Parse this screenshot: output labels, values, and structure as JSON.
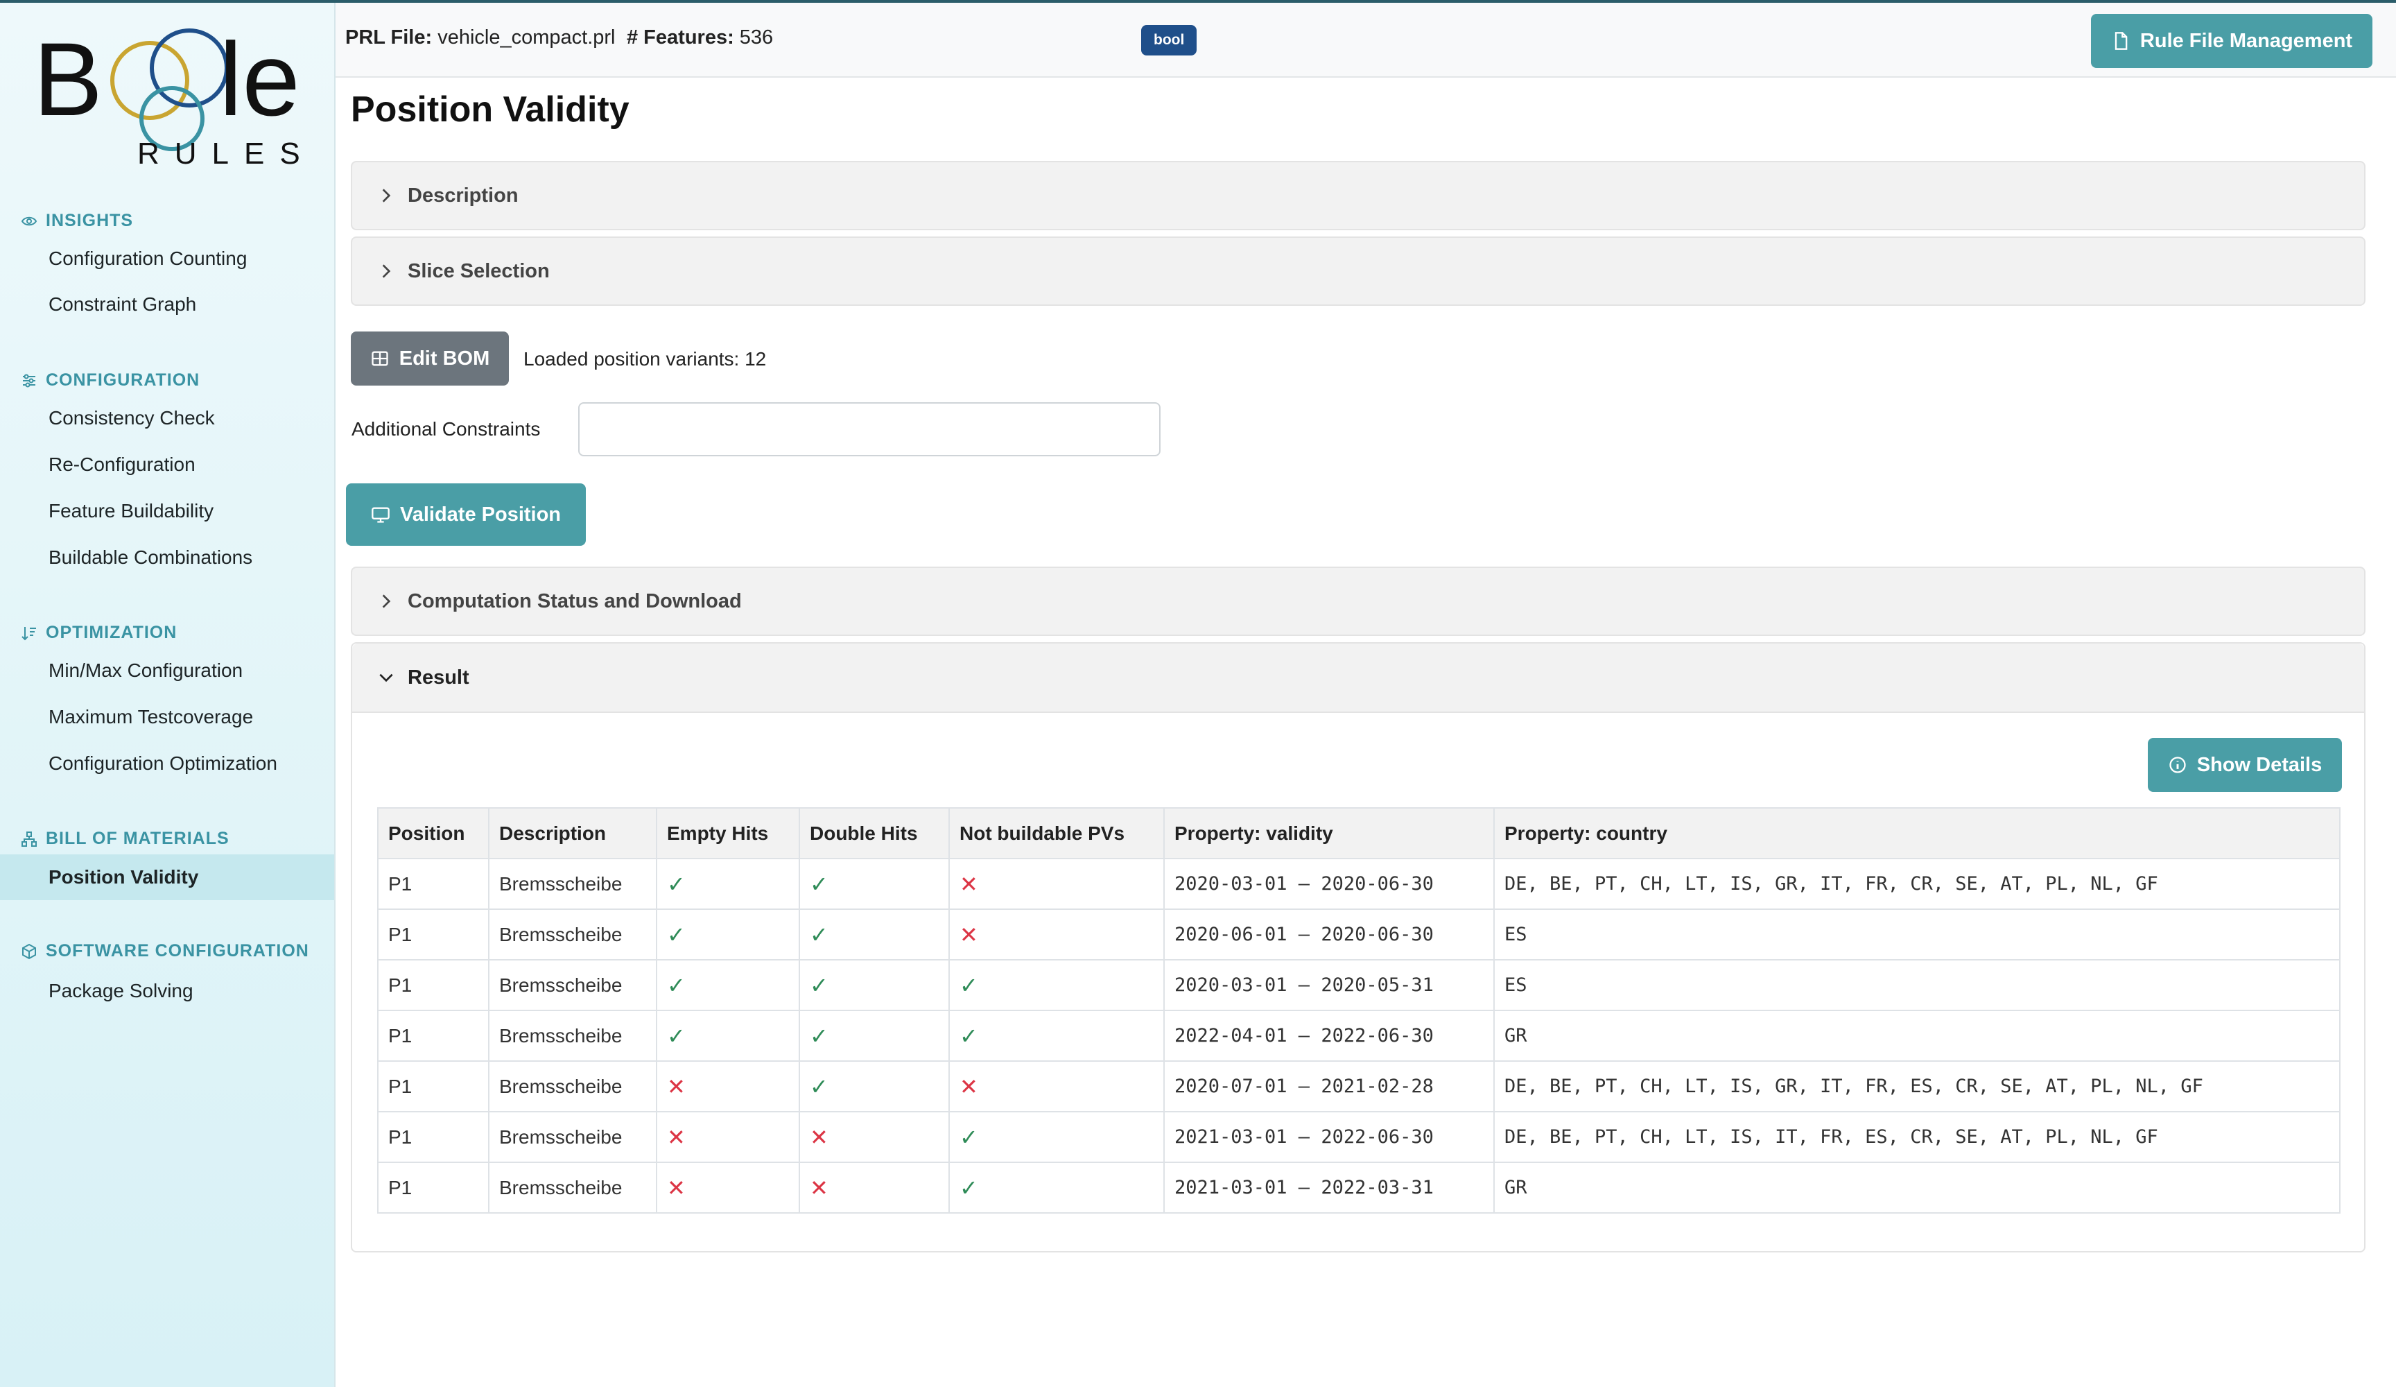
{
  "logo": {
    "text_top": "BOOle",
    "text_bottom": "RULES"
  },
  "sidebar": {
    "sections": [
      {
        "label": "INSIGHTS",
        "icon": "eye-icon",
        "items": [
          "Configuration Counting",
          "Constraint Graph"
        ]
      },
      {
        "label": "CONFIGURATION",
        "icon": "sliders-icon",
        "items": [
          "Consistency Check",
          "Re-Configuration",
          "Feature Buildability",
          "Buildable Combinations"
        ]
      },
      {
        "label": "OPTIMIZATION",
        "icon": "sort-icon",
        "items": [
          "Min/Max Configuration",
          "Maximum Testcoverage",
          "Configuration Optimization"
        ]
      },
      {
        "label": "BILL OF MATERIALS",
        "icon": "hierarchy-icon",
        "items": [
          "Position Validity"
        ]
      },
      {
        "label": "SOFTWARE CONFIGURATION",
        "icon": "box-icon",
        "items": [
          "Package Solving"
        ]
      }
    ],
    "active_item": "Position Validity"
  },
  "header": {
    "prl_label": "PRL File:",
    "prl_value": "vehicle_compact.prl",
    "features_label": "# Features:",
    "features_value": "536",
    "badge": "bool",
    "rule_button": "Rule File Management"
  },
  "page": {
    "title": "Position Validity",
    "accordions": {
      "description": "Description",
      "slice_selection": "Slice Selection",
      "computation": "Computation Status and Download",
      "result": "Result"
    },
    "edit_bom_label": "Edit BOM",
    "loaded_text": "Loaded position variants: 12",
    "additional_constraints_label": "Additional Constraints",
    "additional_constraints_value": "",
    "validate_button": "Validate Position",
    "show_details_button": "Show Details"
  },
  "table": {
    "headers": [
      "Position",
      "Description",
      "Empty Hits",
      "Double Hits",
      "Not buildable PVs",
      "Property: validity",
      "Property: country"
    ],
    "rows": [
      {
        "position": "P1",
        "description": "Bremsscheibe",
        "empty_hits": true,
        "double_hits": true,
        "not_buildable": false,
        "validity": "2020-03-01 – 2020-06-30",
        "country": "DE, BE, PT, CH, LT, IS, GR, IT, FR, CR, SE, AT, PL, NL, GF"
      },
      {
        "position": "P1",
        "description": "Bremsscheibe",
        "empty_hits": true,
        "double_hits": true,
        "not_buildable": false,
        "validity": "2020-06-01 – 2020-06-30",
        "country": "ES"
      },
      {
        "position": "P1",
        "description": "Bremsscheibe",
        "empty_hits": true,
        "double_hits": true,
        "not_buildable": true,
        "validity": "2020-03-01 – 2020-05-31",
        "country": "ES"
      },
      {
        "position": "P1",
        "description": "Bremsscheibe",
        "empty_hits": true,
        "double_hits": true,
        "not_buildable": true,
        "validity": "2022-04-01 – 2022-06-30",
        "country": "GR"
      },
      {
        "position": "P1",
        "description": "Bremsscheibe",
        "empty_hits": false,
        "double_hits": true,
        "not_buildable": false,
        "validity": "2020-07-01 – 2021-02-28",
        "country": "DE, BE, PT, CH, LT, IS, GR, IT, FR, ES, CR, SE, AT, PL, NL, GF"
      },
      {
        "position": "P1",
        "description": "Bremsscheibe",
        "empty_hits": false,
        "double_hits": false,
        "not_buildable": true,
        "validity": "2021-03-01 – 2022-06-30",
        "country": "DE, BE, PT, CH, LT, IS, IT, FR, ES, CR, SE, AT, PL, NL, GF"
      },
      {
        "position": "P1",
        "description": "Bremsscheibe",
        "empty_hits": false,
        "double_hits": false,
        "not_buildable": true,
        "validity": "2021-03-01 – 2022-03-31",
        "country": "GR"
      }
    ]
  },
  "colors": {
    "accent": "#4a9ea6",
    "ok": "#2e8b57",
    "bad": "#dc3545",
    "badge": "#1f4f8a"
  }
}
